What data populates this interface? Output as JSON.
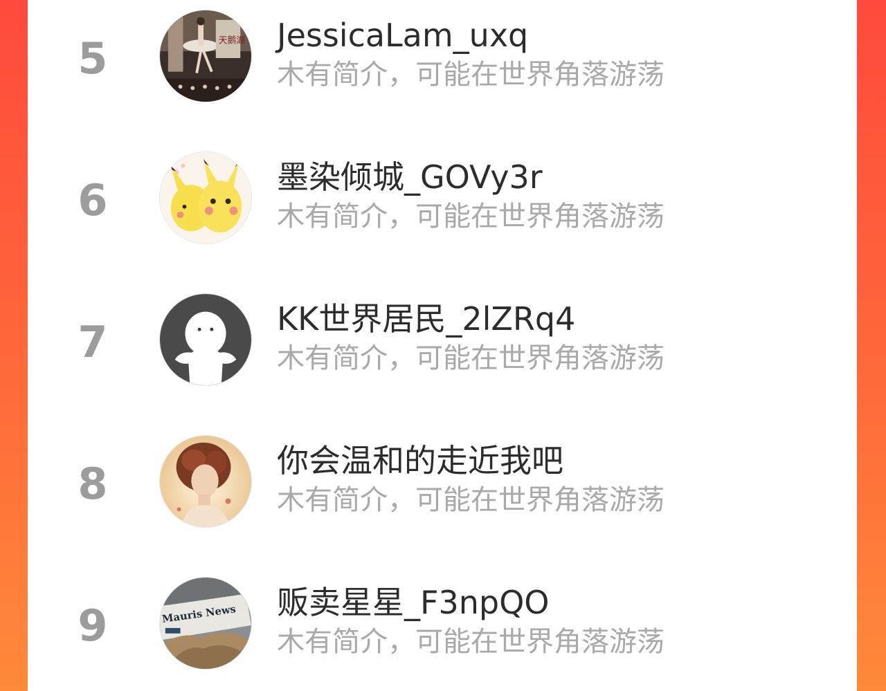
{
  "list": {
    "items": [
      {
        "rank": "5",
        "name": "JessicaLam_uxq",
        "bio": "木有简介，可能在世界角落游荡",
        "avatar": "ballet-poster-avatar"
      },
      {
        "rank": "6",
        "name": "墨染倾城_GOVy3r",
        "bio": "木有简介，可能在世界角落游荡",
        "avatar": "pikachu-avatar"
      },
      {
        "rank": "7",
        "name": "KK世界居民_2lZRq4",
        "bio": "木有简介，可能在世界角落游荡",
        "avatar": "default-ghost-avatar"
      },
      {
        "rank": "8",
        "name": "你会温和的走近我吧",
        "bio": "木有简介，可能在世界角落游荡",
        "avatar": "painted-girl-avatar"
      },
      {
        "rank": "9",
        "name": "贩卖星星_F3npQO",
        "bio": "木有简介，可能在世界角落游荡",
        "avatar": "newspaper-sand-avatar"
      }
    ]
  },
  "avatar_art": {
    "newspaper_text": "Mauris News",
    "poster_text": "天鹅湖"
  },
  "colors": {
    "background_top": "#ff4a3d",
    "background_bottom": "#ff8a3a",
    "rank_text": "#9c9c9c",
    "name_text": "#2c2c2c",
    "bio_text": "#a9a9a9"
  }
}
